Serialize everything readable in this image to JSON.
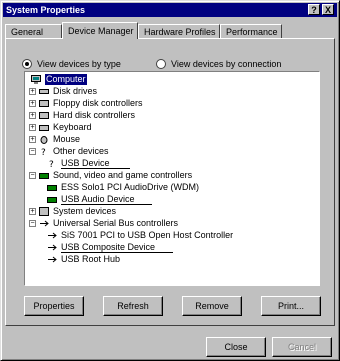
{
  "window": {
    "title": "System Properties",
    "help_glyph": "?",
    "close_glyph": "X"
  },
  "tabs": [
    {
      "label": "General"
    },
    {
      "label": "Device Manager"
    },
    {
      "label": "Hardware Profiles"
    },
    {
      "label": "Performance"
    }
  ],
  "view": {
    "by_type": "View devices by type",
    "by_connection": "View devices by connection",
    "selected": "by_type"
  },
  "tree": {
    "root": "Computer",
    "items": [
      {
        "label": "Disk drives",
        "icon": "disk-drive-icon"
      },
      {
        "label": "Floppy disk controllers",
        "icon": "floppy-controller-icon"
      },
      {
        "label": "Hard disk controllers",
        "icon": "hard-disk-controller-icon"
      },
      {
        "label": "Keyboard",
        "icon": "keyboard-icon"
      },
      {
        "label": "Mouse",
        "icon": "mouse-icon"
      },
      {
        "label": "Other devices",
        "icon": "question-icon",
        "expanded": true,
        "children": [
          {
            "label": "USB Device",
            "icon": "question-icon",
            "underlined": true
          }
        ]
      },
      {
        "label": "Sound, video and game controllers",
        "icon": "sound-card-icon",
        "expanded": true,
        "children": [
          {
            "label": "ESS Solo1 PCI AudioDrive (WDM)",
            "icon": "sound-card-icon"
          },
          {
            "label": "USB Audio Device",
            "icon": "sound-card-icon",
            "underlined": true
          }
        ]
      },
      {
        "label": "System devices",
        "icon": "system-device-icon"
      },
      {
        "label": "Universal Serial Bus controllers",
        "icon": "usb-icon",
        "expanded": true,
        "children": [
          {
            "label": "SiS 7001 PCI to USB Open Host Controller",
            "icon": "usb-icon"
          },
          {
            "label": "USB Composite Device",
            "icon": "usb-icon",
            "underlined": true
          },
          {
            "label": "USB Root Hub",
            "icon": "usb-icon"
          }
        ]
      }
    ]
  },
  "buttons": {
    "properties": "Properties",
    "refresh": "Refresh",
    "remove": "Remove",
    "print": "Print..."
  },
  "footer": {
    "close": "Close",
    "cancel": "Cancel"
  }
}
